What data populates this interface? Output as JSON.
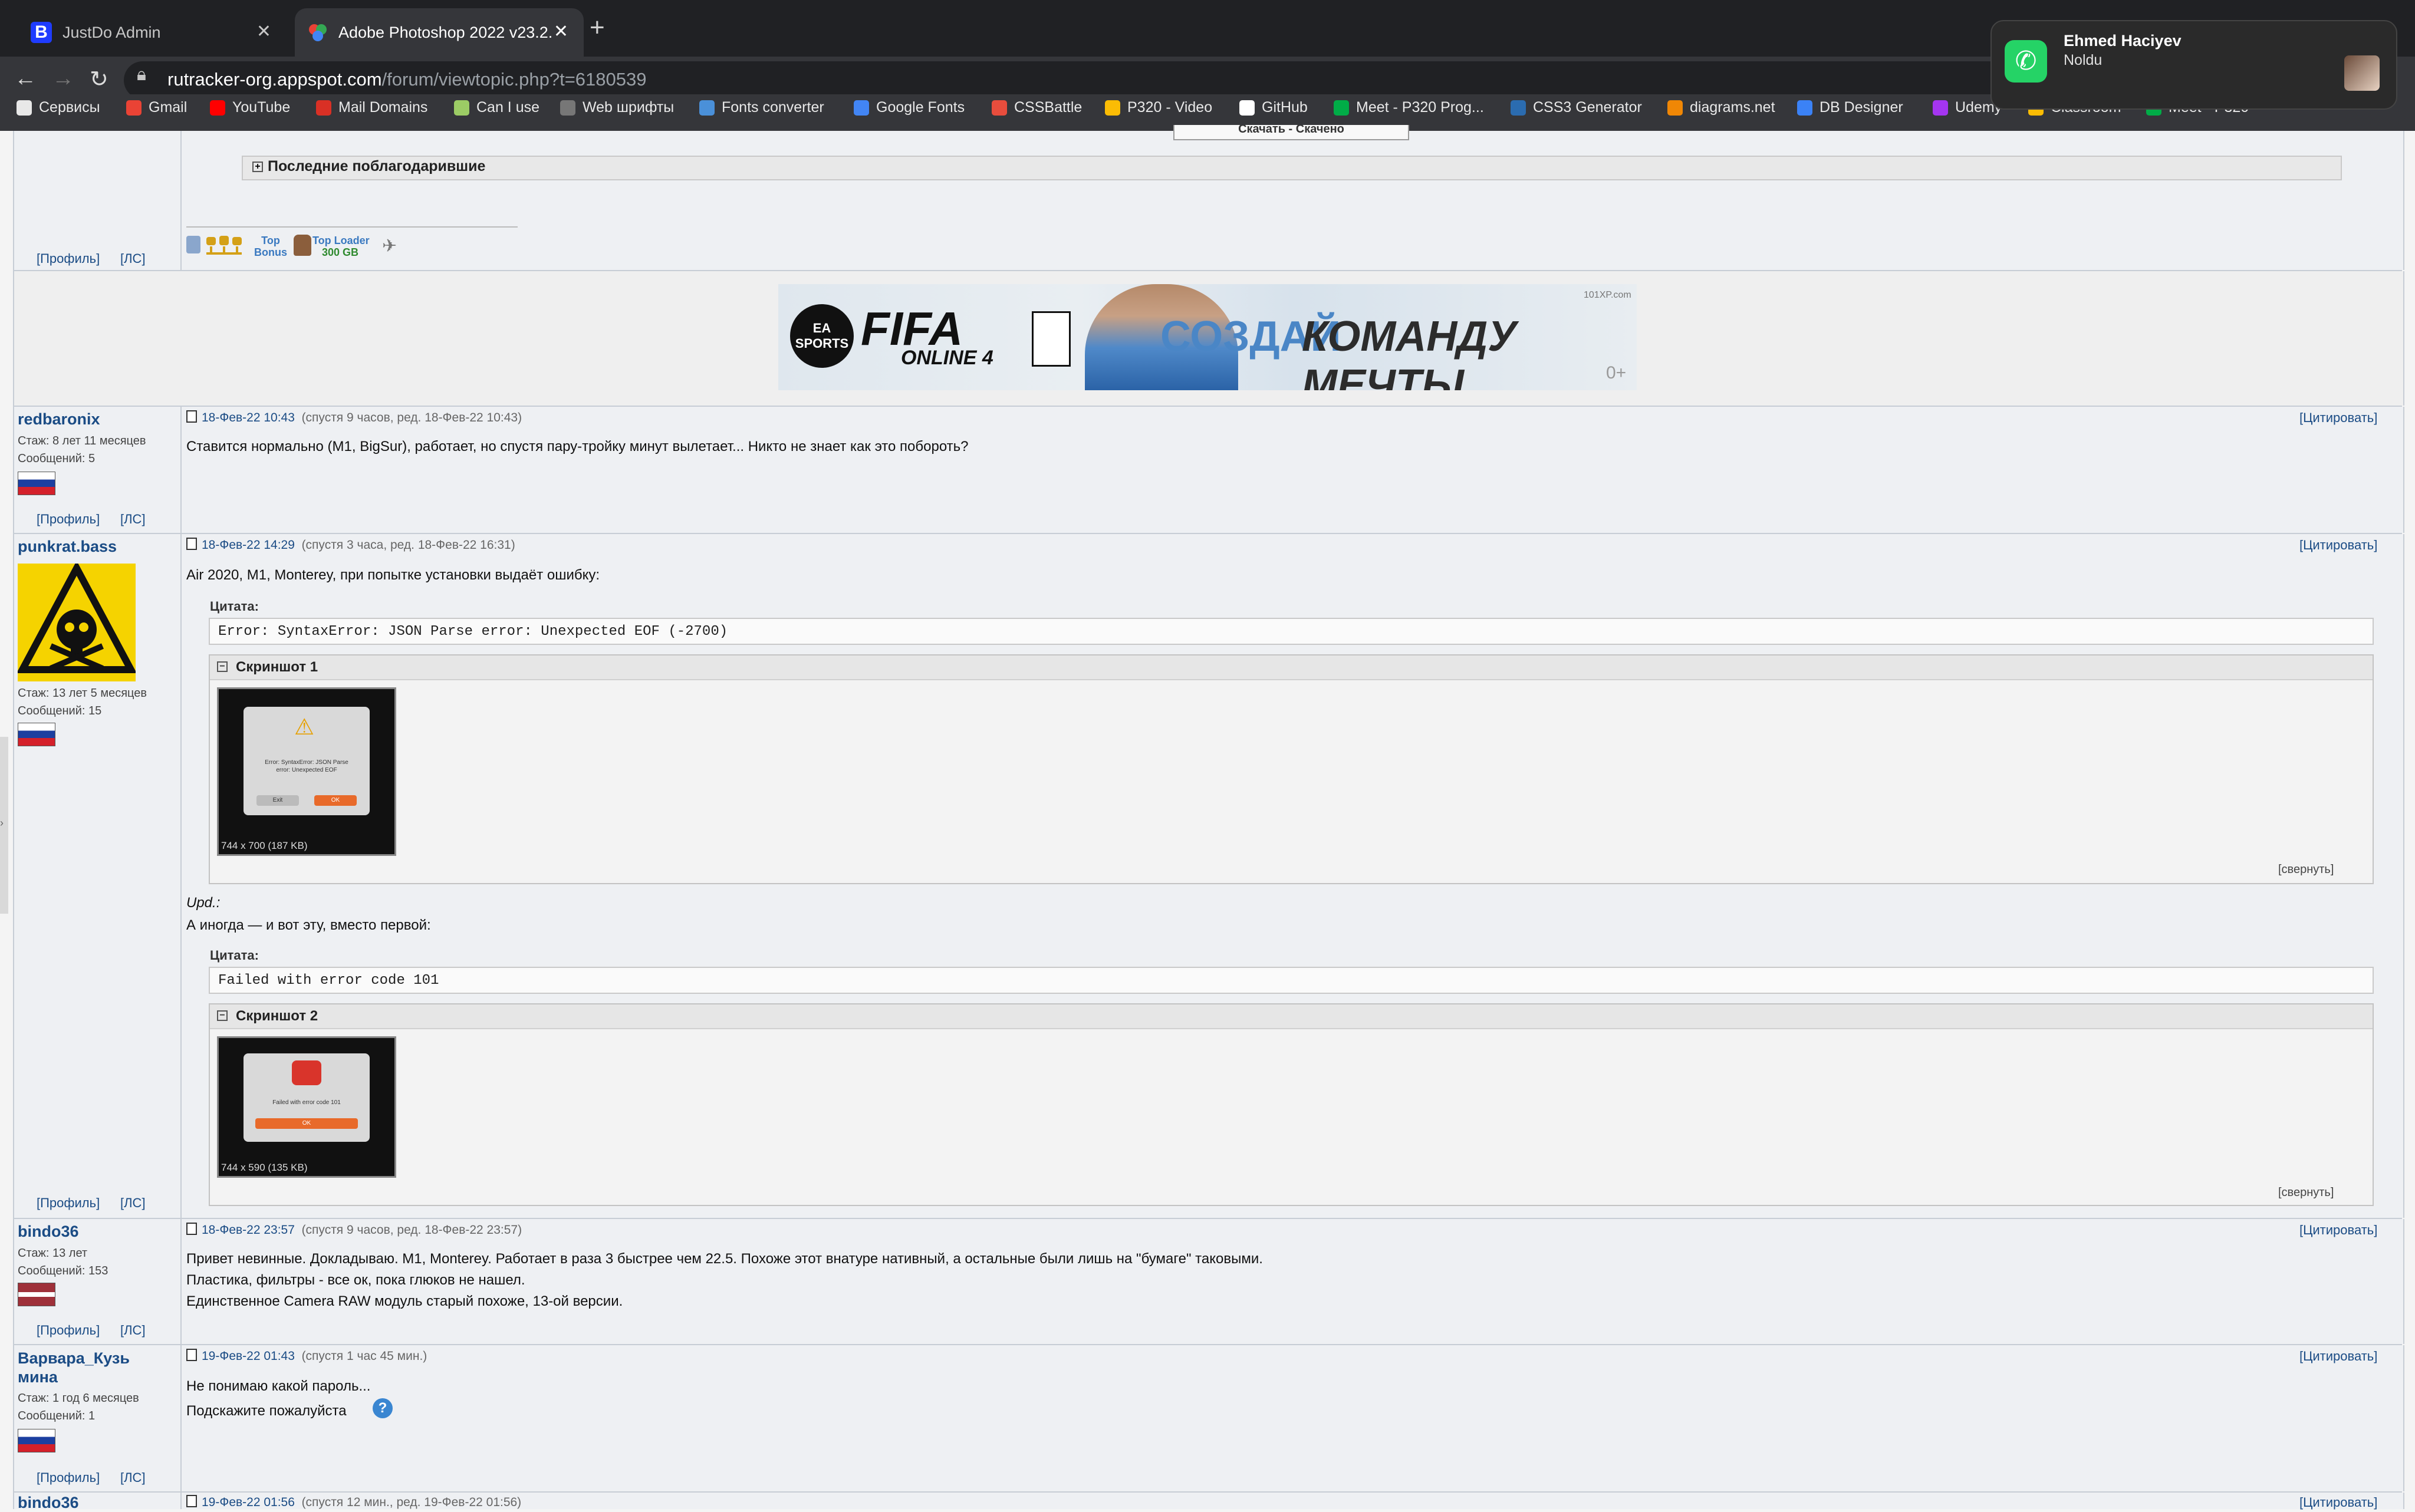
{
  "browser": {
    "tabs": [
      {
        "title": "JustDo Admin",
        "favicon": "B"
      },
      {
        "title": "Adobe Photoshop 2022 v23.2."
      }
    ],
    "url_host": "rutracker-org.appspot.com",
    "url_path": "/forum/viewtopic.php?t=6180539",
    "bookmarks": [
      {
        "label": "Сервисы",
        "color": "#e8e8e8"
      },
      {
        "label": "Gmail",
        "color": "#ea4335"
      },
      {
        "label": "YouTube",
        "color": "#ff0000"
      },
      {
        "label": "Mail Domains",
        "color": "#d93025"
      },
      {
        "label": "Can I use",
        "color": "#9ccc65"
      },
      {
        "label": "Web шрифты",
        "color": "#777777"
      },
      {
        "label": "Fonts converter",
        "color": "#4a90d9"
      },
      {
        "label": "Google Fonts",
        "color": "#4285f4"
      },
      {
        "label": "CSSBattle",
        "color": "#e84d3d"
      },
      {
        "label": "P320 - Video",
        "color": "#fbbc04"
      },
      {
        "label": "GitHub",
        "color": "#ffffff"
      },
      {
        "label": "Meet - P320 Prog...",
        "color": "#00ac47"
      },
      {
        "label": "CSS3 Generator",
        "color": "#2b6cb0"
      },
      {
        "label": "diagrams.net",
        "color": "#f08705"
      },
      {
        "label": "DB Designer",
        "color": "#3b82f6"
      },
      {
        "label": "Udemy",
        "color": "#a435f0"
      },
      {
        "label": "Classroom",
        "color": "#fbbc04"
      },
      {
        "label": "Meet - P320",
        "color": "#00ac47"
      }
    ]
  },
  "notification": {
    "app": "WhatsApp",
    "title": "Ehmed Haciyev",
    "body": "Noldu"
  },
  "top": {
    "last_thanked": "Последние поблагодарившие",
    "top_bonus": "Top Bonus",
    "top_loader": "Top Loader",
    "top_loader_sub": "300 GB",
    "download_btn": "Скачать - Скачено"
  },
  "banner": {
    "brand": "FIFA",
    "brand_sub": "ONLINE 4",
    "ea": "EA SPORTS",
    "slogan_a": "СОЗДАЙ",
    "slogan_b": "КОМАНДУ МЕЧТЫ",
    "age": "0+",
    "site": "101XP.com"
  },
  "links": {
    "profile": "[Профиль]",
    "pm": "[ЛС]",
    "quote": "[Цитировать]",
    "collapse": "[свернуть]",
    "quote_label": "Цитата:"
  },
  "posts": [
    {
      "author": "redbaronix",
      "stazh": "Стаж:",
      "stazh_val": "8 лет 11 месяцев",
      "msgs": "Сообщений:",
      "msgs_val": "5",
      "date": "18-Фев-22 10:43",
      "meta": "(спустя 9 часов, ред. 18-Фев-22 10:43)",
      "text": "Ставится нормально (M1, BigSur), работает, но спустя пару-тройку минут вылетает... Никто не знает как это побороть?"
    },
    {
      "author": "punkrat.bass",
      "stazh": "Стаж:",
      "stazh_val": "13 лет 5 месяцев",
      "msgs": "Сообщений:",
      "msgs_val": "15",
      "date": "18-Фев-22 14:29",
      "meta": "(спустя 3 часа, ред. 18-Фев-22 16:31)",
      "text1": "Air 2020, M1, Monterey, при попытке установки выдаёт ошибку:",
      "quote1": "Error: SyntaxError: JSON Parse error: Unexpected EOF (-2700)",
      "spoiler1": "Скриншот 1",
      "img1": "744 x 700 (187 KB)",
      "img1_l1": "Error: SyntaxError: JSON Parse",
      "img1_l2": "error: Unexpected EOF",
      "img1_btn_cancel": "Exit",
      "img1_btn_ok": "OK",
      "upd": "Upd.:",
      "text2": "А иногда — и вот эту, вместо первой:",
      "quote2": "Failed with error code 101",
      "spoiler2": "Скриншот 2",
      "img2": "744 x 590 (135 KB)",
      "img2_l1": "Failed with error code 101",
      "img2_btn_ok": "OK"
    },
    {
      "author": "bindo36",
      "stazh": "Стаж:",
      "stazh_val": "13 лет",
      "msgs": "Сообщений:",
      "msgs_val": "153",
      "date": "18-Фев-22 23:57",
      "meta": "(спустя 9 часов, ред. 18-Фев-22 23:57)",
      "line1": "Привет невинные. Докладываю. M1, Monterey. Работает в раза 3 быстрее чем 22.5. Похоже этот внатуре нативный, а остальные были лишь на \"бумаге\" таковыми.",
      "line2": "Пластика, фильтры - все ок, пока глюков не нашел.",
      "line3": "Единственное Camera RAW модуль старый похоже, 13-ой версии."
    },
    {
      "author_l1": "Варвара_Кузь",
      "author_l2": "мина",
      "stazh": "Стаж:",
      "stazh_val": "1 год 6 месяцев",
      "msgs": "Сообщений:",
      "msgs_val": "1",
      "date": "19-Фев-22 01:43",
      "meta": "(спустя 1 час 45 мин.)",
      "line1": "Не понимаю какой пароль...",
      "line2": "Подскажите пожалуйста"
    },
    {
      "author": "bindo36",
      "date": "19-Фев-22 01:56",
      "meta": "(спустя 12 мин., ред. 19-Фев-22 01:56)"
    }
  ]
}
